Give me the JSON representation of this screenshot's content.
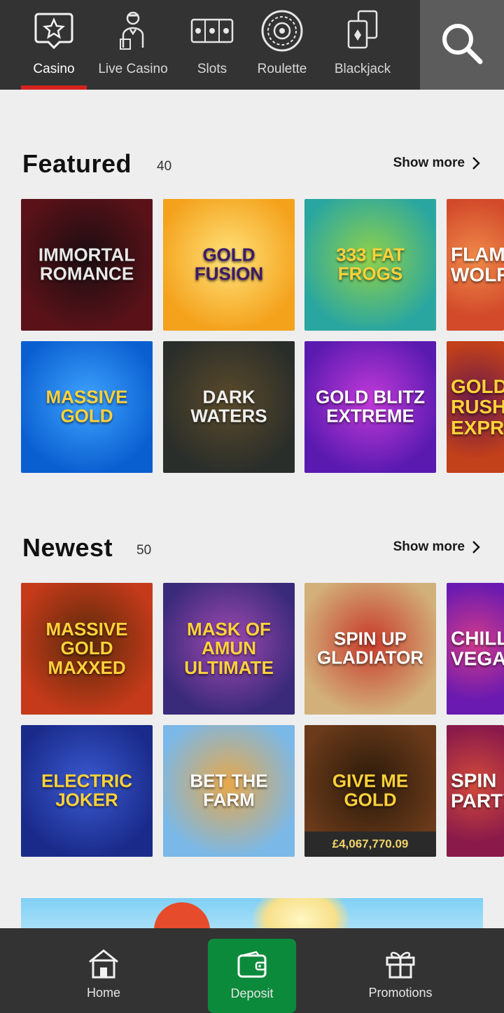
{
  "nav": {
    "categories": [
      {
        "label": "Casino",
        "icon": "star-speech-icon",
        "active": true
      },
      {
        "label": "Live Casino",
        "icon": "dealer-icon",
        "active": false
      },
      {
        "label": "Slots",
        "icon": "slot-machine-icon",
        "active": false
      },
      {
        "label": "Roulette",
        "icon": "roulette-wheel-icon",
        "active": false
      },
      {
        "label": "Blackjack",
        "icon": "playing-cards-icon",
        "active": false
      }
    ],
    "search_icon": "search-icon",
    "accent": "#d6221e"
  },
  "featured": {
    "title": "Featured",
    "count": "40",
    "show_more": "Show more",
    "games": [
      {
        "name": "Immortal Romance",
        "bg": "#5a1218",
        "bg2": "#1a0d12",
        "fg": "#e8e8e8"
      },
      {
        "name": "Gold Fusion",
        "bg": "#f4a21c",
        "bg2": "#ffe27a",
        "fg": "#3a1a6a"
      },
      {
        "name": "333 Fat Frogs",
        "bg": "#2aa6a0",
        "bg2": "#8fd14a",
        "fg": "#ffd23a"
      },
      {
        "name": "Flaming Wolf",
        "bg": "#d24a2a",
        "bg2": "#f08a4a",
        "fg": "#ffffff"
      },
      {
        "name": "Massive Gold",
        "bg": "#0a5fd0",
        "bg2": "#3fa4ff",
        "fg": "#ffd23a"
      },
      {
        "name": "Dark Waters",
        "bg": "#2a2e2a",
        "bg2": "#5a4a2a",
        "fg": "#f0f0f0"
      },
      {
        "name": "Gold Blitz Extreme",
        "bg": "#5a1ab0",
        "bg2": "#c23ad8",
        "fg": "#ffffff"
      },
      {
        "name": "Gold Rush Express",
        "bg": "#c2401a",
        "bg2": "#6a1a4a",
        "fg": "#ffd23a"
      }
    ]
  },
  "newest": {
    "title": "Newest",
    "count": "50",
    "show_more": "Show more",
    "games": [
      {
        "name": "Massive Gold Maxxed",
        "bg": "#c43a1a",
        "bg2": "#5a2a0a",
        "fg": "#ffd23a"
      },
      {
        "name": "Mask of Amun Ultimate",
        "bg": "#3a2a7a",
        "bg2": "#a04ab0",
        "fg": "#ffd23a"
      },
      {
        "name": "Spin Up Gladiator",
        "bg": "#d2b07a",
        "bg2": "#c83a2a",
        "fg": "#ffffff"
      },
      {
        "name": "Chilli Vegas",
        "bg": "#6a1ab0",
        "bg2": "#d23a8a",
        "fg": "#ffffff"
      },
      {
        "name": "Electric Joker",
        "bg": "#1a2a8a",
        "bg2": "#3a5ad0",
        "fg": "#ffd23a"
      },
      {
        "name": "Bet the Farm",
        "bg": "#7ab8e8",
        "bg2": "#e8a84a",
        "fg": "#ffffff"
      },
      {
        "name": "Give Me Gold",
        "bg": "#6a3a1a",
        "bg2": "#2a1a0a",
        "fg": "#ffd23a",
        "jackpot": "£4,067,770.09"
      },
      {
        "name": "Spin Party",
        "bg": "#8a1a4a",
        "bg2": "#d24a3a",
        "fg": "#ffffff"
      }
    ]
  },
  "bottom_nav": {
    "items": [
      {
        "label": "Home",
        "icon": "home-icon"
      },
      {
        "label": "Deposit",
        "icon": "wallet-icon",
        "active": true
      },
      {
        "label": "Promotions",
        "icon": "gift-icon"
      }
    ],
    "deposit_color": "#0c8a3c"
  }
}
